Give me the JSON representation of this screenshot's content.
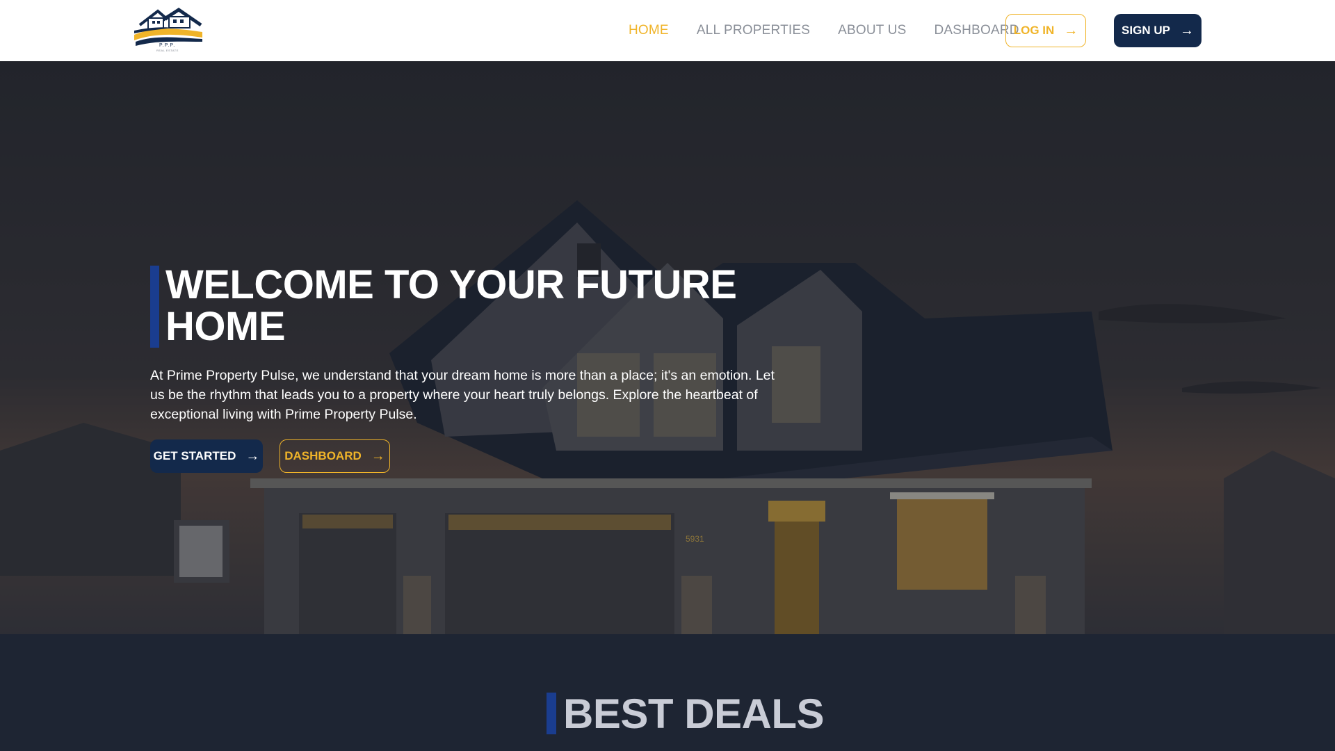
{
  "header": {
    "logo_caption": "P.P.P.",
    "logo_subcaption": "REAL ESTATE",
    "nav": [
      {
        "label": "HOME",
        "active": true
      },
      {
        "label": "ALL PROPERTIES",
        "active": false
      },
      {
        "label": "ABOUT US",
        "active": false
      },
      {
        "label": "DASHBOARD",
        "active": false
      }
    ],
    "login_label": "LOG IN",
    "signup_label": "SIGN UP"
  },
  "hero": {
    "title_line1": "WELCOME TO YOUR FUTURE",
    "title_line2": "HOME",
    "description": "At Prime Property Pulse, we understand that your dream home is more than a place; it's an emotion. Let us be the rhythm that leads you to a property where your heart truly belongs. Explore the heartbeat of exceptional living with Prime Property Pulse.",
    "get_started_label": "GET STARTED",
    "dashboard_label": "DASHBOARD",
    "house_number": "5931"
  },
  "deals": {
    "title": "BEST DEALS"
  },
  "colors": {
    "accent": "#f0b429",
    "primary": "#13294b",
    "bar": "#1a3d8f",
    "section_bg": "#1e2533"
  },
  "icons": [
    "house-logo-icon",
    "arrow-right-icon"
  ]
}
